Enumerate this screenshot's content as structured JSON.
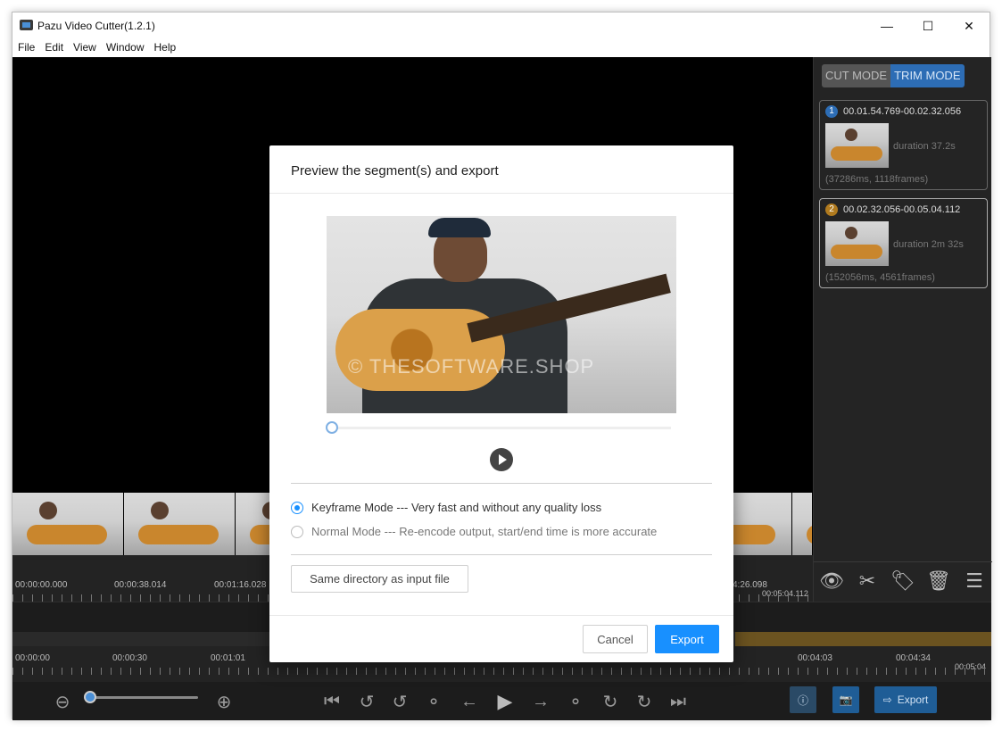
{
  "window": {
    "title": "Pazu Video Cutter(1.2.1)"
  },
  "menu": [
    "File",
    "Edit",
    "View",
    "Window",
    "Help"
  ],
  "modes": {
    "cut": "CUT MODE",
    "trim": "TRIM MODE"
  },
  "segments": [
    {
      "num": "1",
      "range": "00.01.54.769-00.02.32.056",
      "duration": "duration 37.2s",
      "meta": "(37286ms, 1118frames)",
      "color": "#2d6db5"
    },
    {
      "num": "2",
      "range": "00.02.32.056-00.05.04.112",
      "duration": "duration 2m 32s",
      "meta": "(152056ms, 4561frames)",
      "color": "#b07a1e"
    }
  ],
  "timeline_top": {
    "labels": [
      "00:00:00.000",
      "00:00:38.014",
      "00:01:16.028",
      "4:26.098",
      "00:05:04.112"
    ]
  },
  "timeline_bottom": {
    "labels": [
      "00:00:00",
      "00:00:30",
      "00:01:01",
      "00:04:03",
      "00:04:34",
      "00:05:04"
    ]
  },
  "controls": {
    "export_label": "Export"
  },
  "dialog": {
    "title": "Preview the segment(s) and export",
    "watermark": "© THESOFTWARE.SHOP",
    "options": [
      {
        "label": "Keyframe Mode --- Very fast and without any quality loss",
        "checked": true
      },
      {
        "label": "Normal Mode --- Re-encode output, start/end time is more accurate",
        "checked": false
      }
    ],
    "directory_button": "Same directory as input file",
    "cancel": "Cancel",
    "export": "Export"
  },
  "colors": {
    "accent": "#1890ff",
    "trim_mode": "#2d6db5",
    "trim_range": "#6b5320"
  }
}
